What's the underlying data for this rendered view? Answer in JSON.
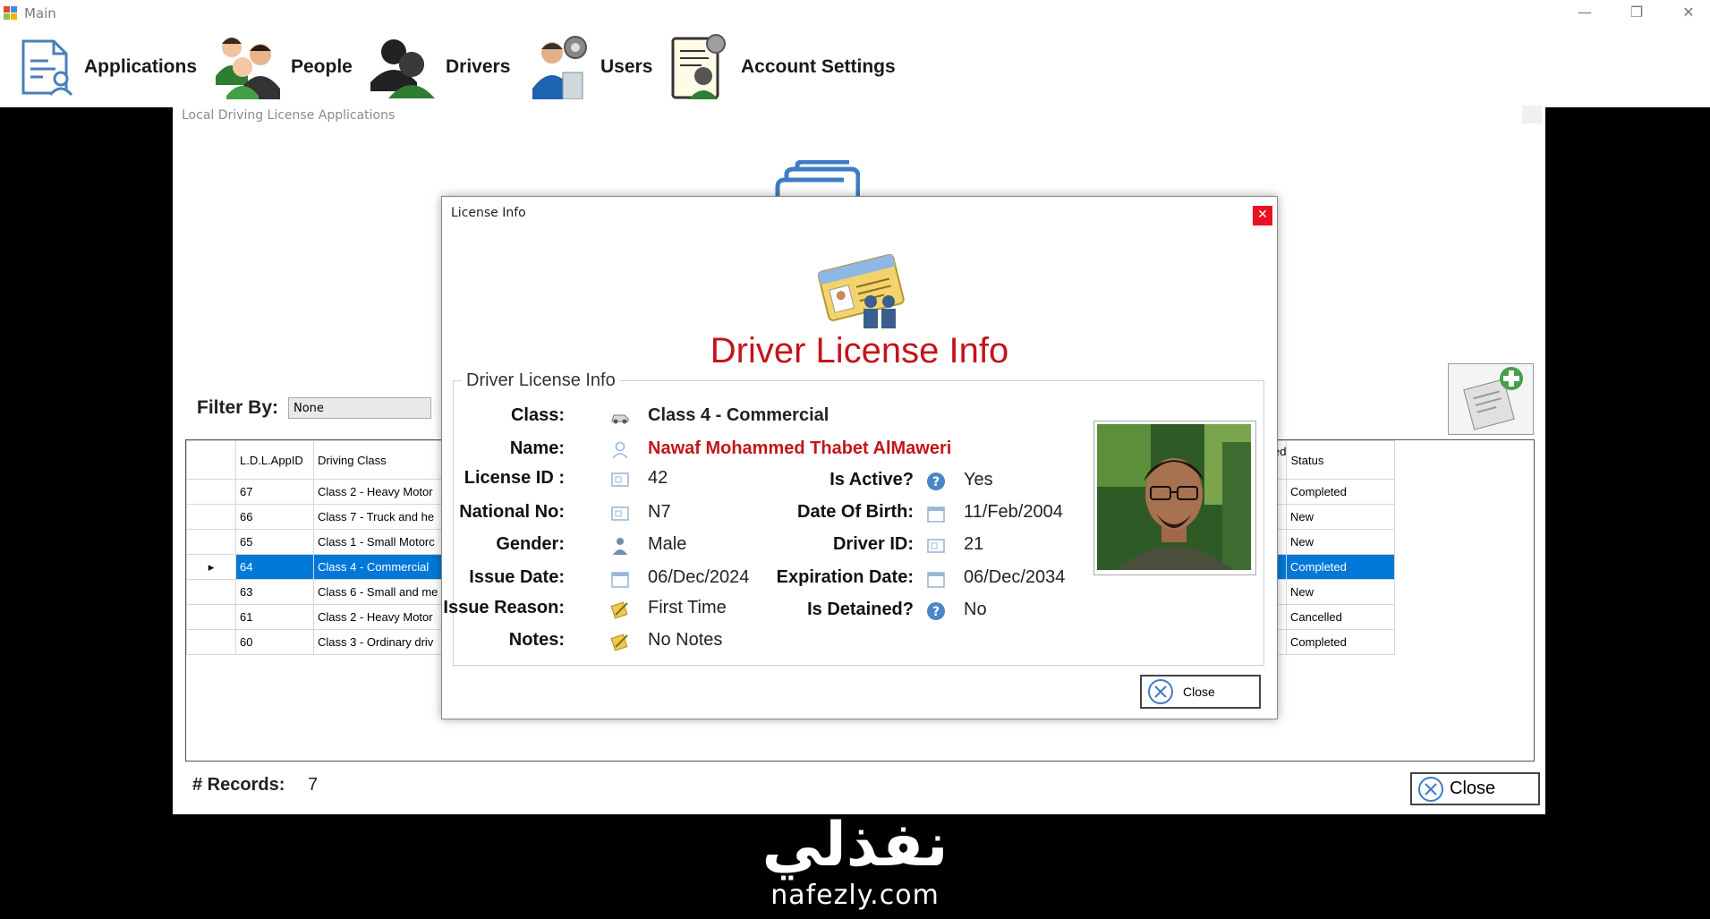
{
  "main_window": {
    "title": "Main"
  },
  "menu": [
    {
      "label": "Applications",
      "icon": "applications-icon"
    },
    {
      "label": "People",
      "icon": "people-icon"
    },
    {
      "label": "Drivers",
      "icon": "drivers-icon"
    },
    {
      "label": "Users",
      "icon": "users-icon"
    },
    {
      "label": "Account Settings",
      "icon": "account-settings-icon"
    }
  ],
  "ldla_window": {
    "title": "Local Driving License Applications",
    "filter_label": "Filter By:",
    "filter_value": "None",
    "columns": [
      "L.D.L.AppID",
      "Driving Class",
      "Status"
    ],
    "partial_column_fragment": "ed",
    "rows": [
      {
        "id": "67",
        "driving_class": "Class 2 - Heavy Motor",
        "status": "Completed"
      },
      {
        "id": "66",
        "driving_class": "Class 7 - Truck and he",
        "status": "New"
      },
      {
        "id": "65",
        "driving_class": "Class 1 - Small Motorc",
        "status": "New"
      },
      {
        "id": "64",
        "driving_class": "Class 4 - Commercial",
        "status": "Completed"
      },
      {
        "id": "63",
        "driving_class": "Class 6 - Small and me",
        "status": "New"
      },
      {
        "id": "61",
        "driving_class": "Class 2 - Heavy Motor",
        "status": "Cancelled"
      },
      {
        "id": "60",
        "driving_class": "Class 3 - Ordinary driv",
        "status": "Completed"
      }
    ],
    "selected_row_index": 3,
    "records_label": "# Records:",
    "records_value": "7",
    "close_label": "Close"
  },
  "license_dialog": {
    "title": "License Info",
    "heading": "Driver License Info",
    "group_title": "Driver License Info",
    "fields": {
      "class_label": "Class:",
      "class_value": "Class 4 - Commercial",
      "name_label": "Name:",
      "name_value": "Nawaf Mohammed Thabet AlMaweri",
      "license_id_label": "License ID :",
      "license_id_value": "42",
      "national_no_label": "National No:",
      "national_no_value": "N7",
      "gender_label": "Gender:",
      "gender_value": "Male",
      "issue_date_label": "Issue Date:",
      "issue_date_value": "06/Dec/2024",
      "issue_reason_label": "Issue Reason:",
      "issue_reason_value": "First Time",
      "notes_label": "Notes:",
      "notes_value": "No Notes",
      "is_active_label": "Is Active?",
      "is_active_value": "Yes",
      "dob_label": "Date Of Birth:",
      "dob_value": "11/Feb/2004",
      "driver_id_label": "Driver ID:",
      "driver_id_value": "21",
      "expiration_label": "Expiration Date:",
      "expiration_value": "06/Dec/2034",
      "is_detained_label": "Is Detained?",
      "is_detained_value": "No"
    },
    "close_label": "Close"
  },
  "watermark": {
    "arabic": "نفذلي",
    "url": "nafezly.com"
  },
  "colors": {
    "accent": "#c3151b",
    "selection": "#0078d7",
    "close_x": "#e81123"
  }
}
